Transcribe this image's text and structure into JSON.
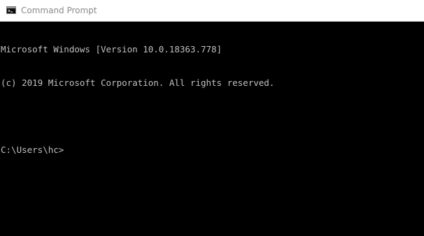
{
  "window": {
    "title": "Command Prompt",
    "icon": "cmd-icon"
  },
  "console": {
    "lines": [
      "Microsoft Windows [Version 10.0.18363.778]",
      "(c) 2019 Microsoft Corporation. All rights reserved.",
      ""
    ],
    "prompt": "C:\\Users\\hc>",
    "input": ""
  },
  "colors": {
    "console_background": "#000000",
    "console_text": "#c0c0c0",
    "titlebar_background": "#ffffff",
    "title_text": "#8a8a8a"
  }
}
